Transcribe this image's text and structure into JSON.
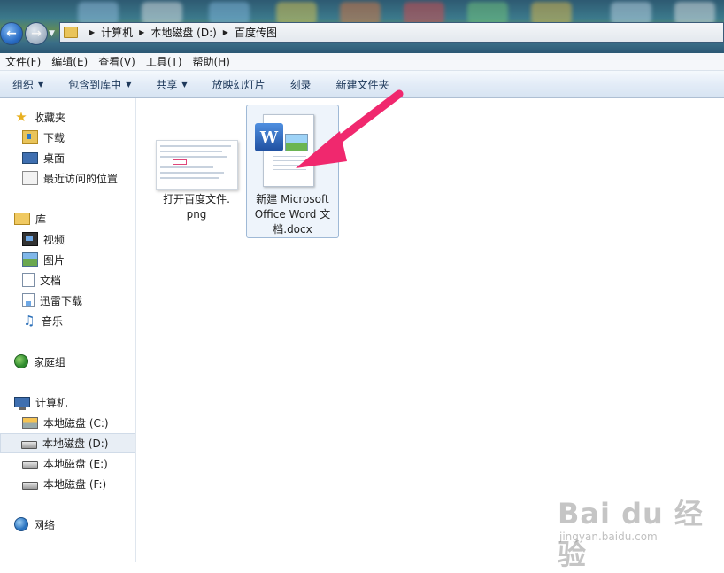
{
  "address": {
    "segments": [
      "计算机",
      "本地磁盘 (D:)",
      "百度传图"
    ]
  },
  "menu": [
    "文件(F)",
    "编辑(E)",
    "查看(V)",
    "工具(T)",
    "帮助(H)"
  ],
  "commands": [
    {
      "label": "组织",
      "dropdown": true
    },
    {
      "label": "包含到库中",
      "dropdown": true
    },
    {
      "label": "共享",
      "dropdown": true
    },
    {
      "label": "放映幻灯片",
      "dropdown": false
    },
    {
      "label": "刻录",
      "dropdown": false
    },
    {
      "label": "新建文件夹",
      "dropdown": false
    }
  ],
  "nav": {
    "favorites": {
      "title": "收藏夹",
      "items": [
        "下载",
        "桌面",
        "最近访问的位置"
      ]
    },
    "libraries": {
      "title": "库",
      "items": [
        "视频",
        "图片",
        "文档",
        "迅雷下载",
        "音乐"
      ]
    },
    "homegroup": {
      "title": "家庭组"
    },
    "computer": {
      "title": "计算机",
      "items": [
        "本地磁盘 (C:)",
        "本地磁盘 (D:)",
        "本地磁盘 (E:)",
        "本地磁盘 (F:)"
      ],
      "selected": "本地磁盘 (D:)"
    },
    "network": {
      "title": "网络"
    }
  },
  "files": [
    {
      "name_line1": "打开百度文件.",
      "name_line2": "png"
    },
    {
      "name_line1": "新建 Microsoft",
      "name_line2": "Office Word 文",
      "name_line3": "档.docx"
    }
  ],
  "watermark": {
    "main": "Bai du 经验",
    "sub": "jingyan.baidu.com"
  },
  "colors": {
    "accent_arrow": "#f0286e",
    "selection": "#eef4fb"
  }
}
